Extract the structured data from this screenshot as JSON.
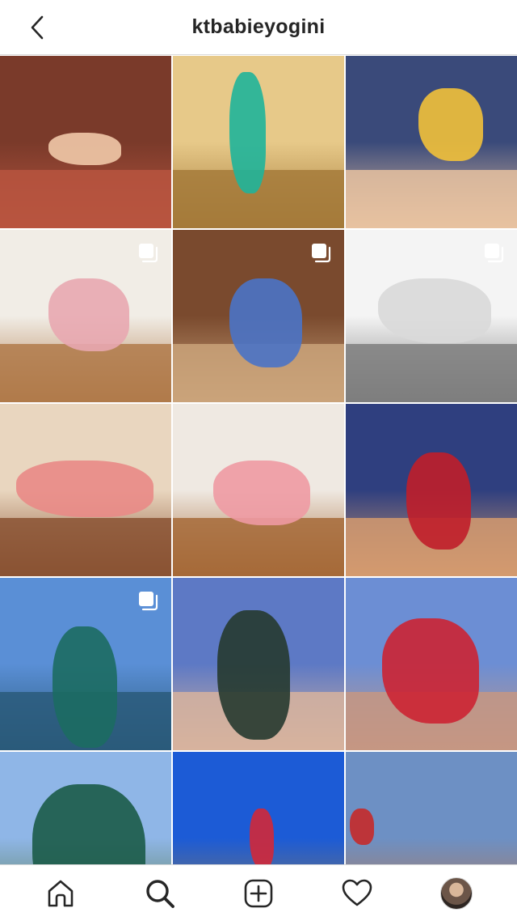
{
  "header": {
    "username": "ktbabieyogini",
    "back_icon": "chevron-left-icon"
  },
  "grid": {
    "multi_photo_icon": "stacked-squares-icon",
    "posts": [
      {
        "multi": false,
        "bg": [
          "#7a3a2a",
          "#b8553f"
        ],
        "fig": "#f1c9a8"
      },
      {
        "multi": false,
        "bg": [
          "#e7c989",
          "#a47a3a"
        ],
        "fig": "#1fb49a"
      },
      {
        "multi": false,
        "bg": [
          "#3a4a7a",
          "#e8c2a0"
        ],
        "fig": "#f2c13a"
      },
      {
        "multi": true,
        "bg": [
          "#f1ede6",
          "#b07a4a"
        ],
        "fig": "#e8a7b0"
      },
      {
        "multi": true,
        "bg": [
          "#7a4a2e",
          "#caa37a"
        ],
        "fig": "#4a73c7"
      },
      {
        "multi": true,
        "bg": [
          "#f4f4f4",
          "#7e7e7e"
        ],
        "fig": "#d9d9d9"
      },
      {
        "multi": false,
        "bg": [
          "#e9d6bf",
          "#8a5233"
        ],
        "fig": "#e98a86"
      },
      {
        "multi": false,
        "bg": [
          "#efe9e2",
          "#a66a38"
        ],
        "fig": "#ee9aa3"
      },
      {
        "multi": false,
        "bg": [
          "#2f3f7f",
          "#d49a6e"
        ],
        "fig": "#c01e2a"
      },
      {
        "multi": true,
        "bg": [
          "#5a8fd6",
          "#2a5a7a"
        ],
        "fig": "#1c6b62"
      },
      {
        "multi": false,
        "bg": [
          "#5d79c5",
          "#d7b39d"
        ],
        "fig": "#263a2f"
      },
      {
        "multi": false,
        "bg": [
          "#6c8ed4",
          "#c69782"
        ],
        "fig": "#cc2433"
      },
      {
        "multi": false,
        "bg": [
          "#8fb6e7",
          "#587b48"
        ],
        "fig": "#1b5b48"
      },
      {
        "multi": false,
        "bg": [
          "#1c5bd6",
          "#8e7a54"
        ],
        "fig": "#d22838"
      },
      {
        "multi": false,
        "bg": [
          "#6d90c4",
          "#b8744a"
        ],
        "fig": "#c52a2a"
      }
    ]
  },
  "tabbar": {
    "tabs": [
      {
        "name": "tab-home",
        "icon": "home-icon"
      },
      {
        "name": "tab-search",
        "icon": "search-icon"
      },
      {
        "name": "tab-new-post",
        "icon": "plus-square-icon"
      },
      {
        "name": "tab-activity",
        "icon": "heart-icon"
      },
      {
        "name": "tab-profile",
        "icon": "profile-avatar"
      }
    ]
  }
}
